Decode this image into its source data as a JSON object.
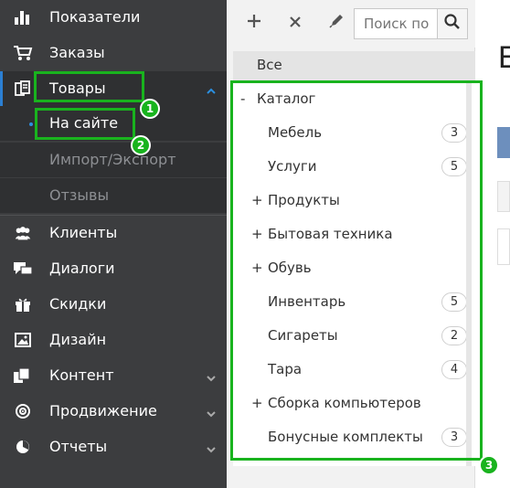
{
  "sidebar": {
    "items": [
      {
        "label": "Показатели",
        "icon": "bar-chart-icon"
      },
      {
        "label": "Заказы",
        "icon": "cart-icon"
      },
      {
        "label": "Товары",
        "icon": "products-icon"
      },
      {
        "label": "Клиенты",
        "icon": "users-icon"
      },
      {
        "label": "Диалоги",
        "icon": "chat-icon"
      },
      {
        "label": "Скидки",
        "icon": "gift-icon"
      },
      {
        "label": "Дизайн",
        "icon": "image-icon"
      },
      {
        "label": "Контент",
        "icon": "content-icon"
      },
      {
        "label": "Продвижение",
        "icon": "target-icon"
      },
      {
        "label": "Отчеты",
        "icon": "pie-chart-icon"
      }
    ],
    "subitems": [
      {
        "label": "На сайте"
      },
      {
        "label": "Импорт/Экспорт"
      },
      {
        "label": "Отзывы"
      }
    ]
  },
  "toolbar": {
    "search_placeholder": "Поиск по",
    "add_icon": "plus-icon",
    "delete_icon": "close-icon",
    "edit_icon": "pencil-icon",
    "search_icon": "search-icon"
  },
  "categories": {
    "all_label": "Все",
    "tree": [
      {
        "toggle": "-",
        "label": "Каталог"
      },
      {
        "toggle": "",
        "label": "Мебель",
        "count": "3"
      },
      {
        "toggle": "",
        "label": "Услуги",
        "count": "5"
      },
      {
        "toggle": "+",
        "label": "Продукты"
      },
      {
        "toggle": "+",
        "label": "Бытовая техника"
      },
      {
        "toggle": "+",
        "label": "Обувь"
      },
      {
        "toggle": "",
        "label": "Инвентарь",
        "count": "5"
      },
      {
        "toggle": "",
        "label": "Сигареты",
        "count": "2"
      },
      {
        "toggle": "",
        "label": "Тара",
        "count": "4"
      },
      {
        "toggle": "+",
        "label": "Сборка компьютеров"
      },
      {
        "toggle": "",
        "label": "Бонусные комплекты",
        "count": "3"
      }
    ]
  },
  "right_panel": {
    "title": "Е"
  },
  "annotations": {
    "markers": [
      "1",
      "2",
      "3"
    ],
    "color": "#19b31e"
  },
  "colors": {
    "sidebar_bg": "#3c3d3f",
    "accent": "#2b7fd3",
    "highlight": "#19b31e"
  }
}
